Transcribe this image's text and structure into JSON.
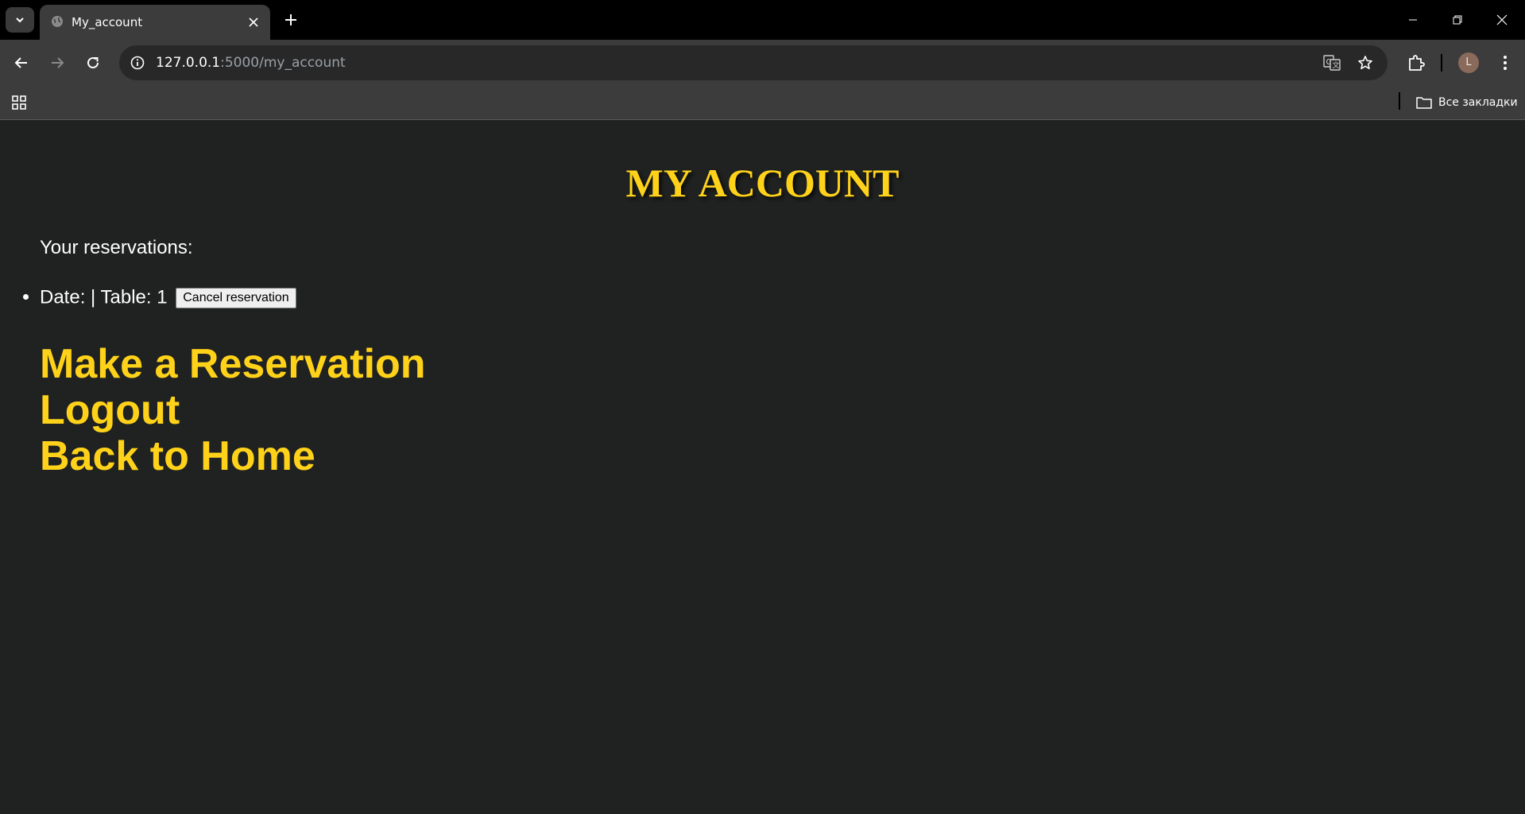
{
  "browser": {
    "tab_title": "My_account",
    "url_host": "127.0.0.1",
    "url_path": ":5000/my_account",
    "avatar_letter": "L",
    "bookmarks_folder_label": "Все закладки"
  },
  "page": {
    "title": "MY ACCOUNT",
    "reservations_label": "Your reservations:",
    "reservations": [
      {
        "text": "Date: | Table: 1",
        "cancel_label": "Cancel reservation"
      }
    ],
    "links": [
      {
        "label": "Make a Reservation"
      },
      {
        "label": "Logout"
      },
      {
        "label": "Back to Home"
      }
    ]
  },
  "colors": {
    "accent": "#ffd21a",
    "background": "#202221",
    "chrome": "#3c3c3c"
  }
}
